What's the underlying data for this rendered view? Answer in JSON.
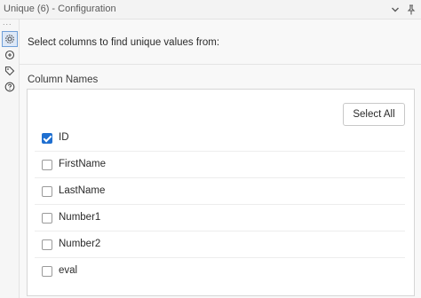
{
  "window": {
    "title": "Unique (6) - Configuration",
    "collapse_icon": "chevron-down-icon",
    "pin_icon": "pin-icon"
  },
  "sidebar": {
    "overflow": "...",
    "icons": [
      {
        "name": "gear-icon",
        "active": true
      },
      {
        "name": "connection-icon",
        "active": false
      },
      {
        "name": "tag-icon",
        "active": false
      },
      {
        "name": "help-icon",
        "active": false
      }
    ]
  },
  "config": {
    "instructions": "Select columns to find unique values from:",
    "section_label": "Column Names",
    "select_all_label": "Select All",
    "columns": [
      {
        "name": "ID",
        "checked": true
      },
      {
        "name": "FirstName",
        "checked": false
      },
      {
        "name": "LastName",
        "checked": false
      },
      {
        "name": "Number1",
        "checked": false
      },
      {
        "name": "Number2",
        "checked": false
      },
      {
        "name": "eval",
        "checked": false
      }
    ]
  },
  "colors": {
    "accent": "#1f6fd0"
  }
}
